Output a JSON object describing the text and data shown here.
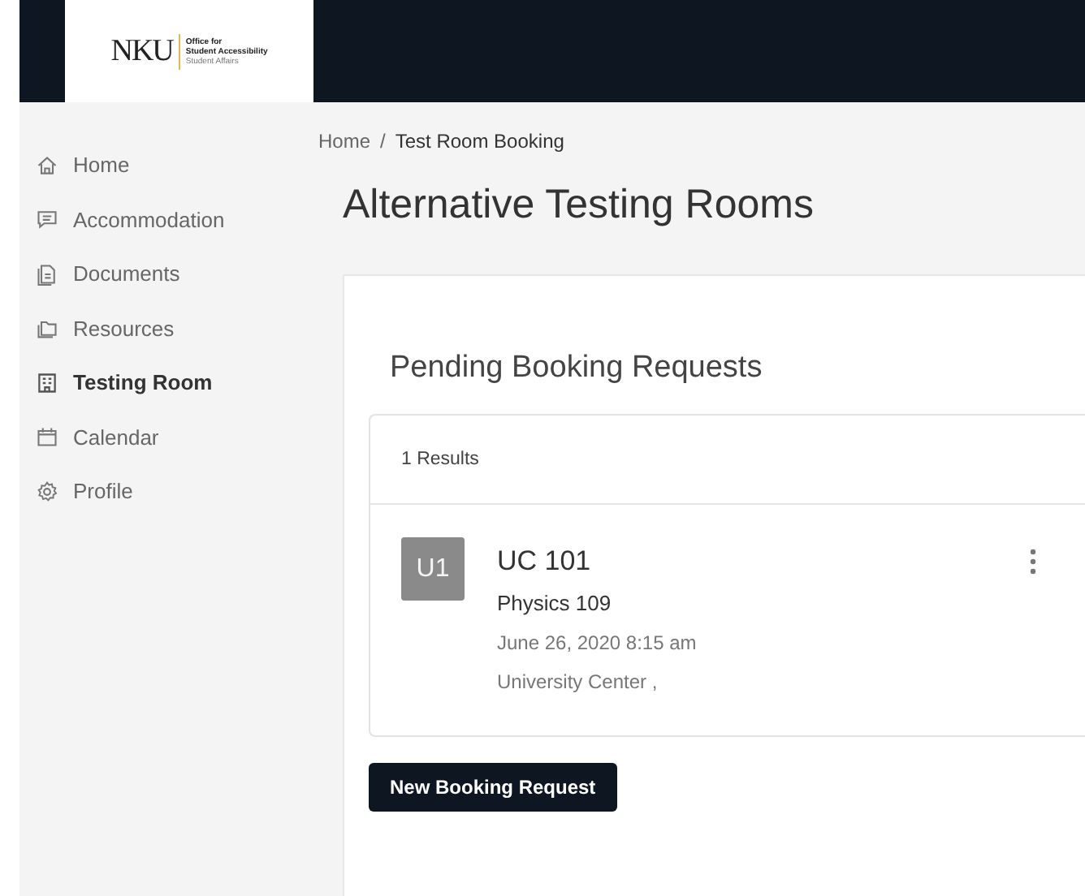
{
  "logo": {
    "wordmark": "NKU",
    "lines": [
      "Office for",
      "Student Accessibility",
      "Student Affairs"
    ]
  },
  "sidebar": {
    "items": [
      {
        "label": "Home",
        "selected": false
      },
      {
        "label": "Accommodation",
        "selected": false
      },
      {
        "label": "Documents",
        "selected": false
      },
      {
        "label": "Resources",
        "selected": false
      },
      {
        "label": "Testing Room",
        "selected": true
      },
      {
        "label": "Calendar",
        "selected": false
      },
      {
        "label": "Profile",
        "selected": false
      }
    ]
  },
  "breadcrumb": [
    "Home",
    "Test Room Booking"
  ],
  "breadcrumb_separator": "/",
  "page_title": "Alternative Testing Rooms",
  "section_title": "Pending Booking Requests",
  "results_count": "1 Results",
  "bookings": [
    {
      "avatar": "U1",
      "room": "UC 101",
      "course": "Physics 109",
      "datetime": "June 26, 2020 8:15 am",
      "location": "University Center ,"
    }
  ],
  "new_button": "New Booking Request"
}
